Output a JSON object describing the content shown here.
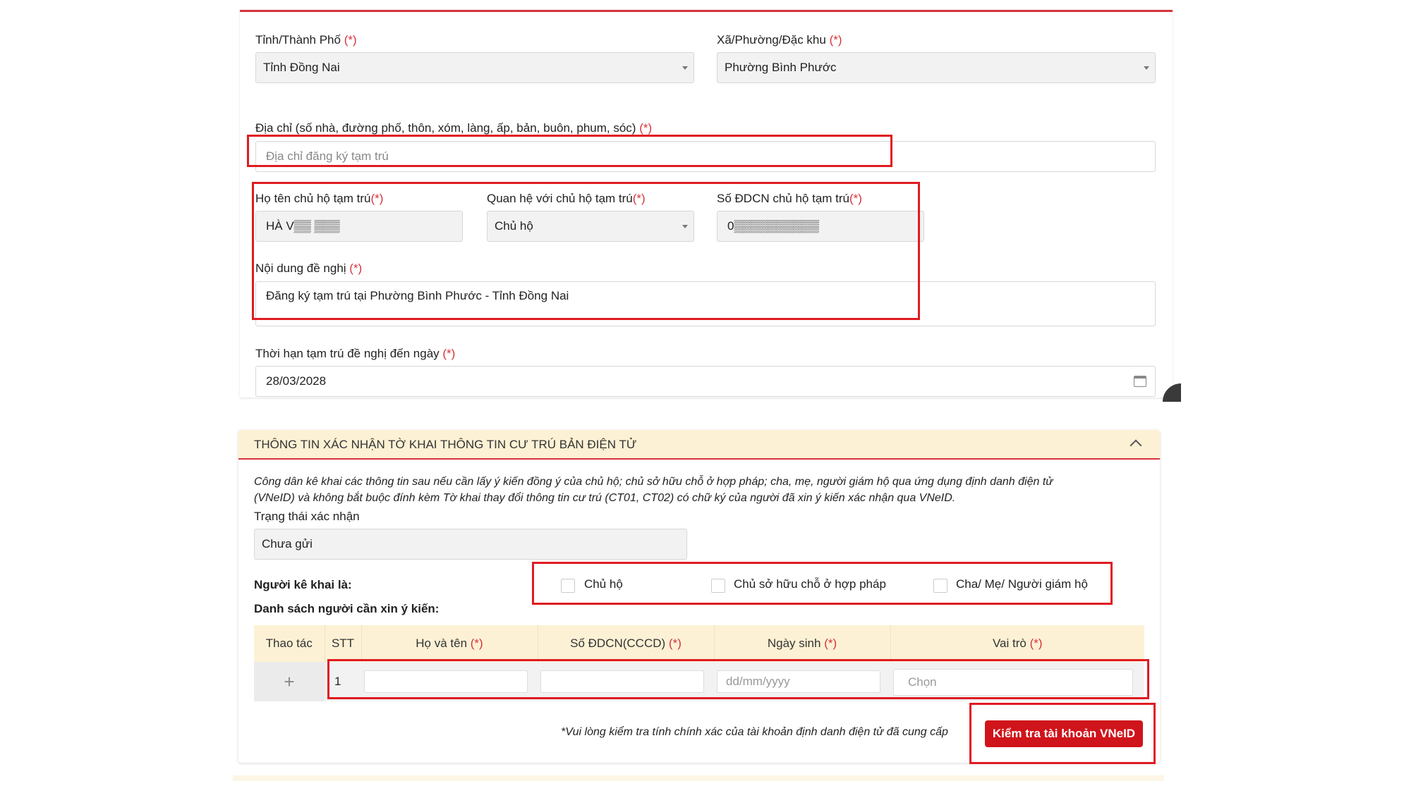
{
  "form": {
    "province_label": "Tỉnh/Thành Phố",
    "province_value": "Tỉnh Đồng Nai",
    "ward_label": "Xã/Phường/Đặc khu",
    "ward_value": "Phường Bình Phước",
    "address_label": "Địa chỉ (số nhà, đường phố, thôn, xóm, làng, ấp, bản, buôn, phum, sóc)",
    "address_placeholder": "Địa chỉ đăng ký tạm trú",
    "host_name_label": "Họ tên chủ hộ tạm trú",
    "host_name_value": "HÀ V▒▒ ▒▒▒",
    "relation_label": "Quan hệ với chủ hộ tạm trú",
    "relation_value": "Chủ hộ",
    "host_id_label": "Số ĐDCN chủ hộ tạm trú",
    "host_id_value": "0▒▒▒▒▒▒▒▒▒▒",
    "content_label": "Nội dung đề nghị",
    "content_value": "Đăng ký tạm trú tại Phường Bình Phước - Tỉnh Đồng Nai",
    "duration_label": "Thời hạn tạm trú đề nghị đến ngày",
    "duration_value": "28/03/2028",
    "required_mark": "(*)",
    "required_mark_tight": "(*)"
  },
  "section2": {
    "title": "THÔNG TIN XÁC NHẬN TỜ KHAI THÔNG TIN CƯ TRÚ BẢN ĐIỆN TỬ",
    "note_line1": "Công dân kê khai các thông tin sau nếu cần lấy ý kiến đồng ý của chủ hộ; chủ sở hữu chỗ ở hợp pháp; cha, mẹ, người giám hộ qua ứng dụng định danh điện tử",
    "note_line2": "(VNeID) và không bắt buộc đính kèm Tờ khai thay đổi thông tin cư trú (CT01, CT02) có chữ ký của người đã xin ý kiến xác nhận qua VNeID.",
    "status_label": "Trạng thái xác nhận",
    "status_value": "Chưa gửi",
    "declarant_label": "Người kê khai là:",
    "options": [
      "Chủ hộ",
      "Chủ sở hữu chỗ ở hợp pháp",
      "Cha/ Mẹ/ Người giám hộ"
    ],
    "list_label": "Danh sách người cần xin ý kiến:",
    "table": {
      "headers": [
        "Thao tác",
        "STT",
        "Họ và tên",
        "Số ĐDCN(CCCD)",
        "Ngày sinh",
        "Vai trò"
      ],
      "row": {
        "stt": "1",
        "dob_placeholder": "dd/mm/yyyy",
        "role_placeholder": "Chọn"
      }
    },
    "verify_note": "*Vui lòng kiểm tra tính chính xác của tài khoản định danh điện tử đã cung cấp",
    "verify_button": "Kiểm tra tài khoản VNeID"
  },
  "colors": {
    "accent_red": "#d6333b",
    "header_bg": "#fdf1d5",
    "button_red": "#d0141b"
  },
  "icons": [
    "chevron-down-icon",
    "calendar-icon",
    "chevron-up-icon",
    "plus-icon"
  ]
}
